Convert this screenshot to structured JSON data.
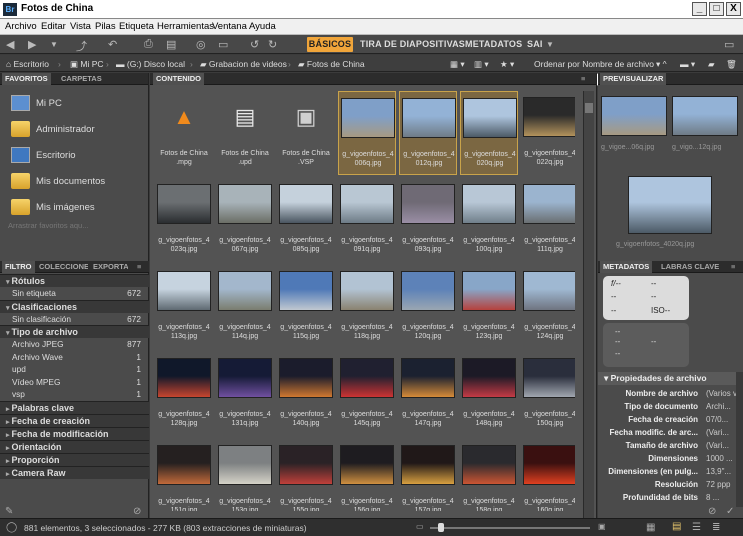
{
  "app": {
    "title": "Fotos de China",
    "logo_text": "Br"
  },
  "window_buttons": {
    "minimize": "_",
    "restore": "□",
    "close": "X"
  },
  "menu": [
    "Archivo",
    "Editar",
    "Vista",
    "Pilas",
    "Etiqueta",
    "Herramientas",
    "Ventana",
    "Ayuda"
  ],
  "workspaces": {
    "active": "BÁSICOS",
    "items": [
      "TIRA DE DIAPOSITIVAS",
      "METADATOS",
      "SAI"
    ]
  },
  "search": {
    "placeholder": "ρ•"
  },
  "path": [
    "Escritorio",
    "Mi PC",
    "(G:) Disco local",
    "Grabacion de videos",
    "Fotos de China"
  ],
  "sort": {
    "label": "Ordenar por Nombre de archivo"
  },
  "left_tabs": [
    "FAVORITOS",
    "CARPETAS"
  ],
  "favorites": [
    "Mi PC",
    "Administrador",
    "Escritorio",
    "Mis documentos",
    "Mis imágenes"
  ],
  "favorites_hint": "Arrastrar favoritos aqu...",
  "filter_tabs": [
    "FILTRO",
    "COLECCIONES",
    "EXPORTAR"
  ],
  "filter": [
    {
      "header": "Rótulos",
      "open": true,
      "rows": [
        {
          "label": "Sin etiqueta",
          "count": "672"
        }
      ]
    },
    {
      "header": "Clasificaciones",
      "open": true,
      "rows": [
        {
          "label": "Sin clasificación",
          "count": "672"
        }
      ]
    },
    {
      "header": "Tipo de archivo",
      "open": true,
      "rows": [
        {
          "label": "Archivo JPEG",
          "count": "877"
        },
        {
          "label": "Archivo Wave",
          "count": "1"
        },
        {
          "label": "upd",
          "count": "1"
        },
        {
          "label": "Vídeo MPEG",
          "count": "1"
        },
        {
          "label": "vsp",
          "count": "1"
        }
      ]
    },
    {
      "header": "Palabras clave",
      "open": false,
      "rows": []
    },
    {
      "header": "Fecha de creación",
      "open": false,
      "rows": []
    },
    {
      "header": "Fecha de modificación",
      "open": false,
      "rows": []
    },
    {
      "header": "Orientación",
      "open": false,
      "rows": []
    },
    {
      "header": "Proporción",
      "open": false,
      "rows": []
    },
    {
      "header": "Camera Raw",
      "open": false,
      "rows": []
    }
  ],
  "content_tab": "CONTENIDO",
  "items": [
    {
      "name": "Fotos de China\n.mpg",
      "kind": "vlc",
      "sel": false
    },
    {
      "name": "Fotos de China\n.upd",
      "kind": "doc",
      "sel": false
    },
    {
      "name": "Fotos de China\n.VSP",
      "kind": "vsp",
      "sel": false
    },
    {
      "name": "g_vigoenfotos_4\n006q.jpg",
      "kind": "photo",
      "c1": "#7f9fc8",
      "c2": "#a79a82",
      "sel": true
    },
    {
      "name": "g_vigoenfotos_4\n012q.jpg",
      "kind": "photo",
      "c1": "#93b2d6",
      "c2": "#6f7b86",
      "sel": true
    },
    {
      "name": "g_vigoenfotos_4\n020q.jpg",
      "kind": "photo",
      "c1": "#aec5de",
      "c2": "#4c5a66",
      "sel": true
    },
    {
      "name": "g_vigoenfotos_4\n022q.jpg",
      "kind": "photo",
      "c1": "#2a2a2a",
      "c2": "#b3925c",
      "sel": false
    },
    {
      "name": "g_vigoenfotos_4\n023q.jpg",
      "kind": "photo",
      "c1": "#6b6f72",
      "c2": "#2a2d30",
      "sel": false
    },
    {
      "name": "g_vigoenfotos_4\n067q.jpg",
      "kind": "photo",
      "c1": "#a8b3b9",
      "c2": "#6b6e66",
      "sel": false
    },
    {
      "name": "g_vigoenfotos_4\n085q.jpg",
      "kind": "photo",
      "c1": "#c5d1dc",
      "c2": "#4a5560",
      "sel": false
    },
    {
      "name": "g_vigoenfotos_4\n091q.jpg",
      "kind": "photo",
      "c1": "#b9c7d3",
      "c2": "#6d7b86",
      "sel": false
    },
    {
      "name": "g_vigoenfotos_4\n093q.jpg",
      "kind": "photo",
      "c1": "#6f6a75",
      "c2": "#9a8ea5",
      "sel": false
    },
    {
      "name": "g_vigoenfotos_4\n100q.jpg",
      "kind": "photo",
      "c1": "#b8c7d6",
      "c2": "#707f8a",
      "sel": false
    },
    {
      "name": "g_vigoenfotos_4\n111q.jpg",
      "kind": "photo",
      "c1": "#9bb4cf",
      "c2": "#6a6f72",
      "sel": false
    },
    {
      "name": "g_vigoenfotos_4\n113q.jpg",
      "kind": "photo",
      "c1": "#c6d3df",
      "c2": "#5f6a72",
      "sel": false
    },
    {
      "name": "g_vigoenfotos_4\n114q.jpg",
      "kind": "photo",
      "c1": "#a3b7cc",
      "c2": "#7a7d6f",
      "sel": false
    },
    {
      "name": "g_vigoenfotos_4\n115q.jpg",
      "kind": "photo",
      "c1": "#4f79b7",
      "c2": "#c0c8d0",
      "sel": false
    },
    {
      "name": "g_vigoenfotos_4\n118q.jpg",
      "kind": "photo",
      "c1": "#b2c3d3",
      "c2": "#8a8270",
      "sel": false
    },
    {
      "name": "g_vigoenfotos_4\n120q.jpg",
      "kind": "photo",
      "c1": "#5d82b8",
      "c2": "#9aa6b2",
      "sel": false
    },
    {
      "name": "g_vigoenfotos_4\n123q.jpg",
      "kind": "photo",
      "c1": "#88a6c8",
      "c2": "#b6423d",
      "sel": false
    },
    {
      "name": "g_vigoenfotos_4\n124q.jpg",
      "kind": "photo",
      "c1": "#9fb8d2",
      "c2": "#6f7480",
      "sel": false
    },
    {
      "name": "g_vigoenfotos_4\n128q.jpg",
      "kind": "photo",
      "c1": "#10182a",
      "c2": "#c7452f",
      "sel": false
    },
    {
      "name": "g_vigoenfotos_4\n131q.jpg",
      "kind": "photo",
      "c1": "#151b36",
      "c2": "#7050a0",
      "sel": false
    },
    {
      "name": "g_vigoenfotos_4\n140q.jpg",
      "kind": "photo",
      "c1": "#1b1c2c",
      "c2": "#d07830",
      "sel": false
    },
    {
      "name": "g_vigoenfotos_4\n145q.jpg",
      "kind": "photo",
      "c1": "#202030",
      "c2": "#cc3333",
      "sel": false
    },
    {
      "name": "g_vigoenfotos_4\n147q.jpg",
      "kind": "photo",
      "c1": "#1b2130",
      "c2": "#d68b38",
      "sel": false
    },
    {
      "name": "g_vigoenfotos_4\n148q.jpg",
      "kind": "photo",
      "c1": "#1c1a26",
      "c2": "#c43a45",
      "sel": false
    },
    {
      "name": "g_vigoenfotos_4\n150q.jpg",
      "kind": "photo",
      "c1": "#2a2e3c",
      "c2": "#a1a7b0",
      "sel": false
    },
    {
      "name": "g_vigoenfotos_4\n151q.jpg",
      "kind": "photo",
      "c1": "#252020",
      "c2": "#c26a3a",
      "sel": false
    },
    {
      "name": "g_vigoenfotos_4\n153q.jpg",
      "kind": "photo",
      "c1": "#7d8082",
      "c2": "#d5d3c8",
      "sel": false
    },
    {
      "name": "g_vigoenfotos_4\n155q.jpg",
      "kind": "photo",
      "c1": "#2a2226",
      "c2": "#c0403a",
      "sel": false
    },
    {
      "name": "g_vigoenfotos_4\n156q.jpg",
      "kind": "photo",
      "c1": "#1e1c20",
      "c2": "#d09040",
      "sel": false
    },
    {
      "name": "g_vigoenfotos_4\n157q.jpg",
      "kind": "photo",
      "c1": "#201818",
      "c2": "#d8a040",
      "sel": false
    },
    {
      "name": "g_vigoenfotos_4\n158q.jpg",
      "kind": "photo",
      "c1": "#2a2a2e",
      "c2": "#cc5533",
      "sel": false
    },
    {
      "name": "g_vigoenfotos_4\n160q.jpg",
      "kind": "photo",
      "c1": "#3a1010",
      "c2": "#e04020",
      "sel": false
    }
  ],
  "preview_tab": "PREVISUALIZAR",
  "previews": [
    {
      "name": "g_vigoe...06q.jpg",
      "c1": "#7f9fc8",
      "c2": "#a79a82"
    },
    {
      "name": "g_vigo...12q.jpg",
      "c1": "#93b2d6",
      "c2": "#6f7b86"
    },
    {
      "name": "g_vigoenfotos_4020q.jpg",
      "c1": "#aec5de",
      "c2": "#4c5a66"
    }
  ],
  "meta_tabs": [
    "METADATOS",
    "LABRAS CLAVE"
  ],
  "camera": {
    "aperture": "f/--",
    "shutter": "--",
    "row2a": "--",
    "row2b": "--",
    "row3a": "--",
    "iso": "ISO--"
  },
  "camera2": [
    "--",
    "--",
    "--",
    "--"
  ],
  "file_props": {
    "header": "Propiedades de archivo",
    "rows": [
      {
        "k": "Nombre de archivo",
        "v": "(Varios valores)"
      },
      {
        "k": "Tipo de documento",
        "v": "Archi..."
      },
      {
        "k": "Fecha de creación",
        "v": "07/0..."
      },
      {
        "k": "Fecha modific. de arc...",
        "v": "(Vari..."
      },
      {
        "k": "Tamaño de archivo",
        "v": "(Vari..."
      },
      {
        "k": "Dimensiones",
        "v": "1000 ..."
      },
      {
        "k": "Dimensiones (en pulg...",
        "v": "13,9\"..."
      },
      {
        "k": "Resolución",
        "v": "72 ppp"
      },
      {
        "k": "Profundidad de bits",
        "v": "8 ..."
      }
    ]
  },
  "status": "881 elementos, 3 seleccionados - 277 KB (803 extracciones de miniaturas)"
}
